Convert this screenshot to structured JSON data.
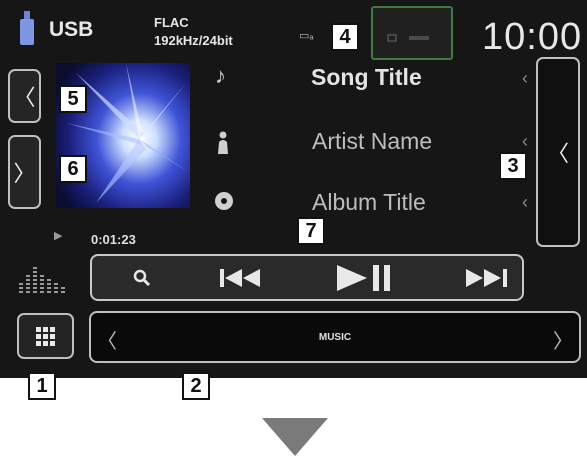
{
  "status": {
    "source": "USB",
    "format_line1": "FLAC",
    "format_line2": "192kHz/24bit",
    "clock": "10:00"
  },
  "track": {
    "title": "Song Title",
    "artist": "Artist Name",
    "album": "Album Title",
    "elapsed": "0:01:23"
  },
  "music_bar": {
    "label": "MUSIC"
  },
  "callouts": [
    "1",
    "2",
    "3",
    "4",
    "5",
    "6",
    "7"
  ],
  "icons": {
    "source": "usb-icon",
    "note": "music-note-icon",
    "artist": "person-icon",
    "album": "disc-icon",
    "search": "search-icon",
    "prev": "previous-track-icon",
    "playpause": "play-pause-icon",
    "next": "next-track-icon",
    "menu": "grid-menu-icon",
    "eq": "equalizer-icon"
  },
  "colors": {
    "screen_bg": "#161616",
    "button_border": "#bfbfbf",
    "highlight_border": "#3f7a3f",
    "text": "#e8e8e8"
  }
}
